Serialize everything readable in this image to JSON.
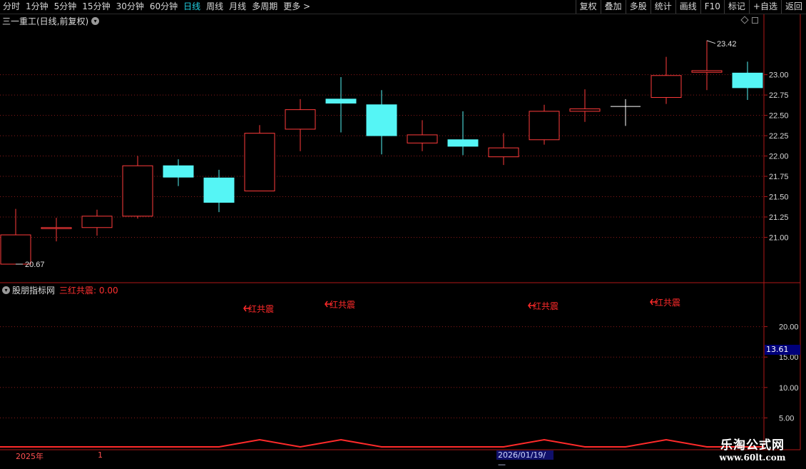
{
  "toolbar": {
    "periods": [
      "分时",
      "1分钟",
      "5分钟",
      "15分钟",
      "30分钟",
      "60分钟",
      "日线",
      "周线",
      "月线",
      "多周期",
      "更多 >"
    ],
    "active_period": "日线",
    "tools": [
      "复权",
      "叠加",
      "多股",
      "统计",
      "画线",
      "F10",
      "标记",
      "+自选",
      "返回"
    ]
  },
  "header": {
    "title": "三一重工(日线,前复权)"
  },
  "indicator": {
    "name": "股朋指标网",
    "series_label": "三红共震: 0.00",
    "readout": "13.61"
  },
  "signal_label": "红共震",
  "dates": {
    "start": "2025年",
    "marker": "1",
    "cursor": "2026/01/19/—"
  },
  "watermark": {
    "name": "乐淘公式网",
    "url": "www.60lt.com"
  },
  "colors": {
    "up": "#ff3b3b",
    "down": "#55f5f5",
    "grid": "#8a1a1a",
    "signal": "#ff2a2a",
    "active_tab": "#22d3e6"
  },
  "chart_data": [
    {
      "type": "candlestick",
      "price_axis": [
        21.0,
        21.25,
        21.5,
        21.75,
        22.0,
        22.25,
        22.5,
        22.75,
        23.0
      ],
      "price_labels": [
        "21.00",
        "21.25",
        "21.50",
        "21.75",
        "22.00",
        "22.25",
        "22.50",
        "22.75",
        "23.00"
      ],
      "ylim": [
        20.6,
        23.55
      ],
      "high_label": "23.42",
      "low_label": "20.67",
      "candles": [
        {
          "o": 20.67,
          "h": 21.35,
          "l": 20.67,
          "c": 21.03,
          "d": "up"
        },
        {
          "o": 21.12,
          "h": 21.24,
          "l": 20.95,
          "c": 21.11,
          "d": "up"
        },
        {
          "o": 21.12,
          "h": 21.34,
          "l": 21.02,
          "c": 21.26,
          "d": "up"
        },
        {
          "o": 21.26,
          "h": 22.0,
          "l": 21.23,
          "c": 21.88,
          "d": "up"
        },
        {
          "o": 21.88,
          "h": 21.96,
          "l": 21.63,
          "c": 21.74,
          "d": "down"
        },
        {
          "o": 21.73,
          "h": 21.83,
          "l": 21.31,
          "c": 21.43,
          "d": "down"
        },
        {
          "o": 21.57,
          "h": 22.38,
          "l": 21.57,
          "c": 22.28,
          "d": "up"
        },
        {
          "o": 22.33,
          "h": 22.7,
          "l": 22.06,
          "c": 22.57,
          "d": "up"
        },
        {
          "o": 22.7,
          "h": 22.97,
          "l": 22.29,
          "c": 22.65,
          "d": "down"
        },
        {
          "o": 22.63,
          "h": 22.81,
          "l": 22.02,
          "c": 22.25,
          "d": "down"
        },
        {
          "o": 22.16,
          "h": 22.44,
          "l": 22.06,
          "c": 22.26,
          "d": "up"
        },
        {
          "o": 22.2,
          "h": 22.55,
          "l": 22.01,
          "c": 22.12,
          "d": "down"
        },
        {
          "o": 21.99,
          "h": 22.28,
          "l": 21.89,
          "c": 22.1,
          "d": "up"
        },
        {
          "o": 22.2,
          "h": 22.63,
          "l": 22.14,
          "c": 22.55,
          "d": "up"
        },
        {
          "o": 22.55,
          "h": 22.82,
          "l": 22.42,
          "c": 22.58,
          "d": "up"
        },
        {
          "o": 22.61,
          "h": 22.7,
          "l": 22.37,
          "c": 22.61,
          "d": "flat"
        },
        {
          "o": 22.72,
          "h": 23.22,
          "l": 22.64,
          "c": 22.99,
          "d": "up"
        },
        {
          "o": 23.03,
          "h": 23.42,
          "l": 22.81,
          "c": 23.05,
          "d": "up"
        },
        {
          "o": 23.02,
          "h": 23.16,
          "l": 22.69,
          "c": 22.84,
          "d": "down"
        }
      ]
    },
    {
      "type": "line",
      "series": [
        {
          "name": "三红共震"
        }
      ],
      "y_ticks": [
        20.0,
        15.0,
        10.0,
        5.0
      ],
      "y_labels": [
        "20.00",
        "15.00",
        "10.00",
        "5.00"
      ],
      "ylim": [
        0,
        25
      ],
      "signal_candle_indices": [
        6,
        8,
        13,
        16
      ]
    }
  ]
}
